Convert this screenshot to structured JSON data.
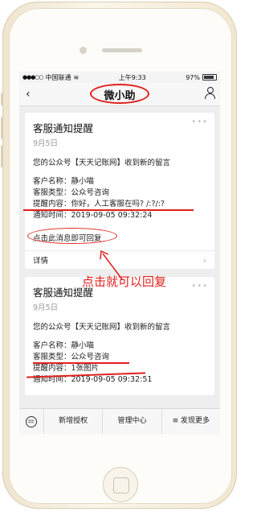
{
  "status_bar": {
    "signal": "●●●○○",
    "carrier": "中国联通",
    "wifi": "≋",
    "time": "上午9:33",
    "battery": "97%"
  },
  "nav": {
    "back_icon": "chevron-left-icon",
    "title": "微小助",
    "profile_icon": "user-icon"
  },
  "cards": [
    {
      "title": "客服通知提醒",
      "date": "9月5日",
      "summary": "您的公众号【天天记账网】收到新的留言",
      "fields": [
        {
          "label": "客户名称：",
          "value": "静小喵"
        },
        {
          "label": "客服类型：",
          "value": "公众号咨询"
        },
        {
          "label": "提醒内容：",
          "value": "你好，人工客服在吗? /:?/:?"
        },
        {
          "label": "通知时间：",
          "value": "2019-09-05 09:32:24"
        }
      ],
      "reply_hint": "点击此消息即可回复",
      "detail_label": "详情"
    },
    {
      "title": "客服通知提醒",
      "date": "9月5日",
      "summary": "您的公众号【天天记账网】收到新的留言",
      "fields": [
        {
          "label": "客户名称：",
          "value": "静小喵"
        },
        {
          "label": "客服类型：",
          "value": "公众号咨询"
        },
        {
          "label": "提醒内容：",
          "value": "1张图片"
        },
        {
          "label": "通知时间：",
          "value": "2019-09-05 09:32:51"
        }
      ]
    }
  ],
  "annotation": "点击就可以回复",
  "bottom_menu": [
    "新增授权",
    "管理中心",
    "≡ 发现更多"
  ],
  "colors": {
    "annotation_red": "#e0201c"
  }
}
